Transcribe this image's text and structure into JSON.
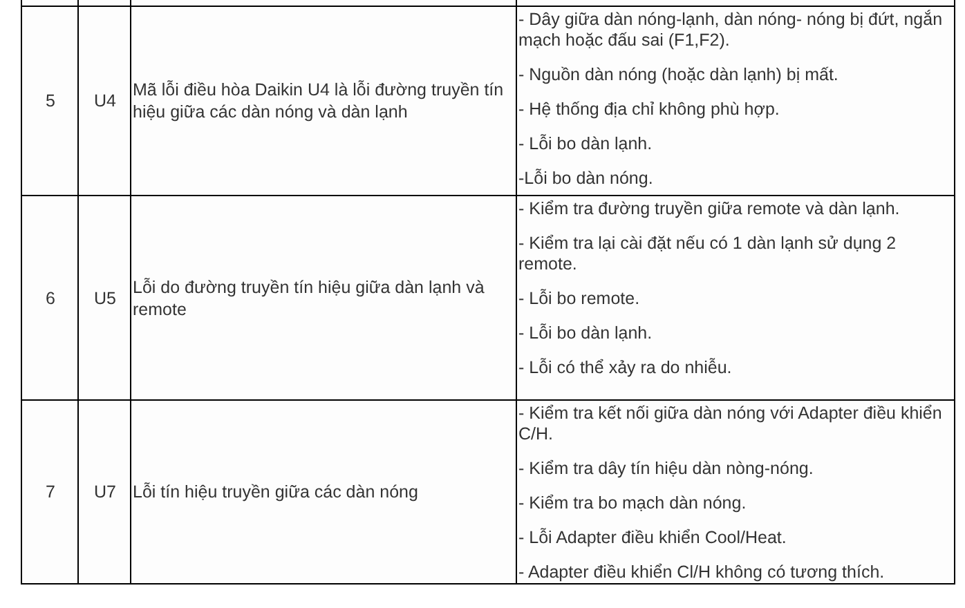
{
  "table": {
    "rows": [
      {
        "no": "5",
        "code": "U4",
        "description": "Mã lỗi điều hòa Daikin U4 là lỗi đường truyền tín hiệu giữa các dàn nóng và dàn lạnh",
        "causes": [
          "- Dây giữa dàn nóng-lạnh, dàn nóng- nóng bị đứt, ngắn mạch hoặc đấu sai (F1,F2).",
          "- Nguồn dàn nóng (hoặc dàn lạnh) bị mất.",
          "- Hệ thống địa chỉ không phù hợp.",
          "- Lỗi bo dàn lạnh.",
          "-Lỗi bo dàn nóng."
        ]
      },
      {
        "no": "6",
        "code": "U5",
        "description": "Lỗi do đường truyền tín hiệu giữa dàn lạnh và remote",
        "causes": [
          "- Kiểm tra đường truyền giữa remote và dàn lạnh.",
          "- Kiểm tra lại cài đặt nếu có 1 dàn lạnh sử dụng 2 remote.",
          "- Lỗi bo remote.",
          "- Lỗi bo dàn lạnh.",
          "- Lỗi có thể xảy ra do nhiễu."
        ]
      },
      {
        "no": "7",
        "code": "U7",
        "description": "Lỗi tín hiệu truyền giữa các dàn nóng",
        "causes": [
          "- Kiểm tra kết nối giữa dàn nóng với Adapter điều khiển C/H.",
          "- Kiểm tra dây tín hiệu dàn nòng-nóng.",
          "- Kiểm tra bo mạch dàn nóng.",
          "- Lỗi Adapter điều khiển Cool/Heat.",
          "- Adapter điều khiển Cl/H không có tương thích."
        ]
      }
    ]
  }
}
